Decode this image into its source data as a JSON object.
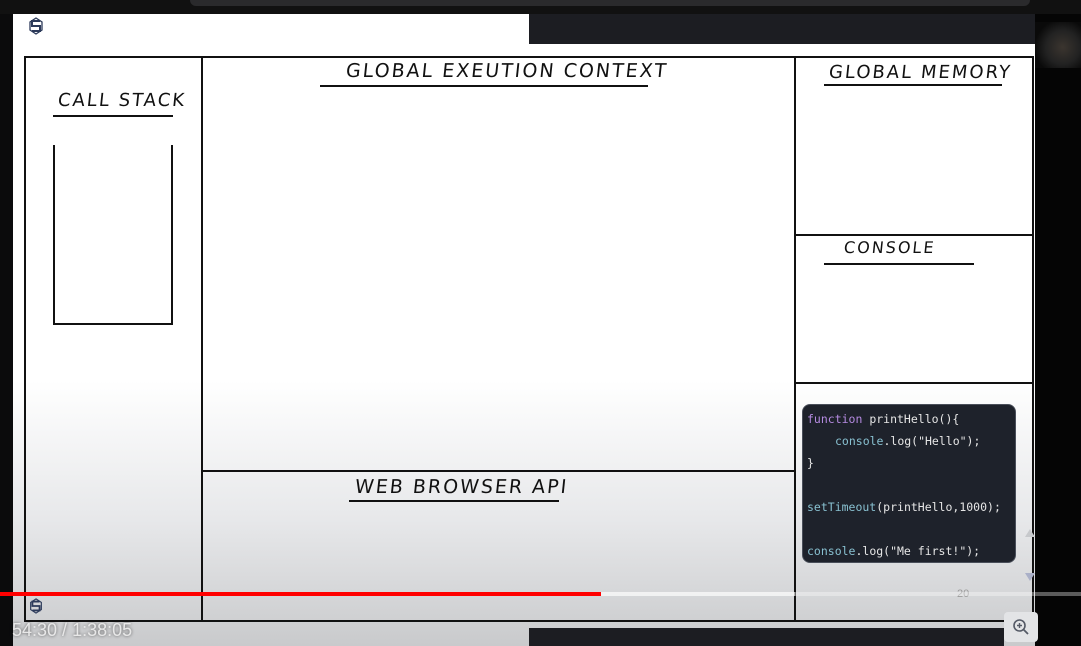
{
  "whiteboard": {
    "call_stack_label": "CALL STACK",
    "global_execution_context_label": "GLOBAL EXEUTION CONTEXT",
    "global_memory_label": "GLOBAL MEMORY",
    "console_label": "CONSOLE",
    "web_browser_api_label": "WEB BROWSER API"
  },
  "code": {
    "line1_kw": "function",
    "line1_rest": " printHello(){",
    "line2_obj": "console",
    "line2_rest": ".log(\"Hello\");",
    "line3": "}",
    "line4_fn": "setTimeout",
    "line4_rest": "(printHello,1000);",
    "line5_obj": "console",
    "line5_rest": ".log(\"Me first!\");"
  },
  "slide_number": "20",
  "player": {
    "time_current": "54:30",
    "time_separator": " / ",
    "time_total": "1:38:05",
    "progress_fraction": 0.5557
  },
  "icons": {
    "brand": "brand-logo-icon",
    "zoom": "zoom-in-icon"
  },
  "colors": {
    "progress": "#ff0000",
    "code_bg": "#1e222b",
    "keyword": "#b48ae0"
  }
}
